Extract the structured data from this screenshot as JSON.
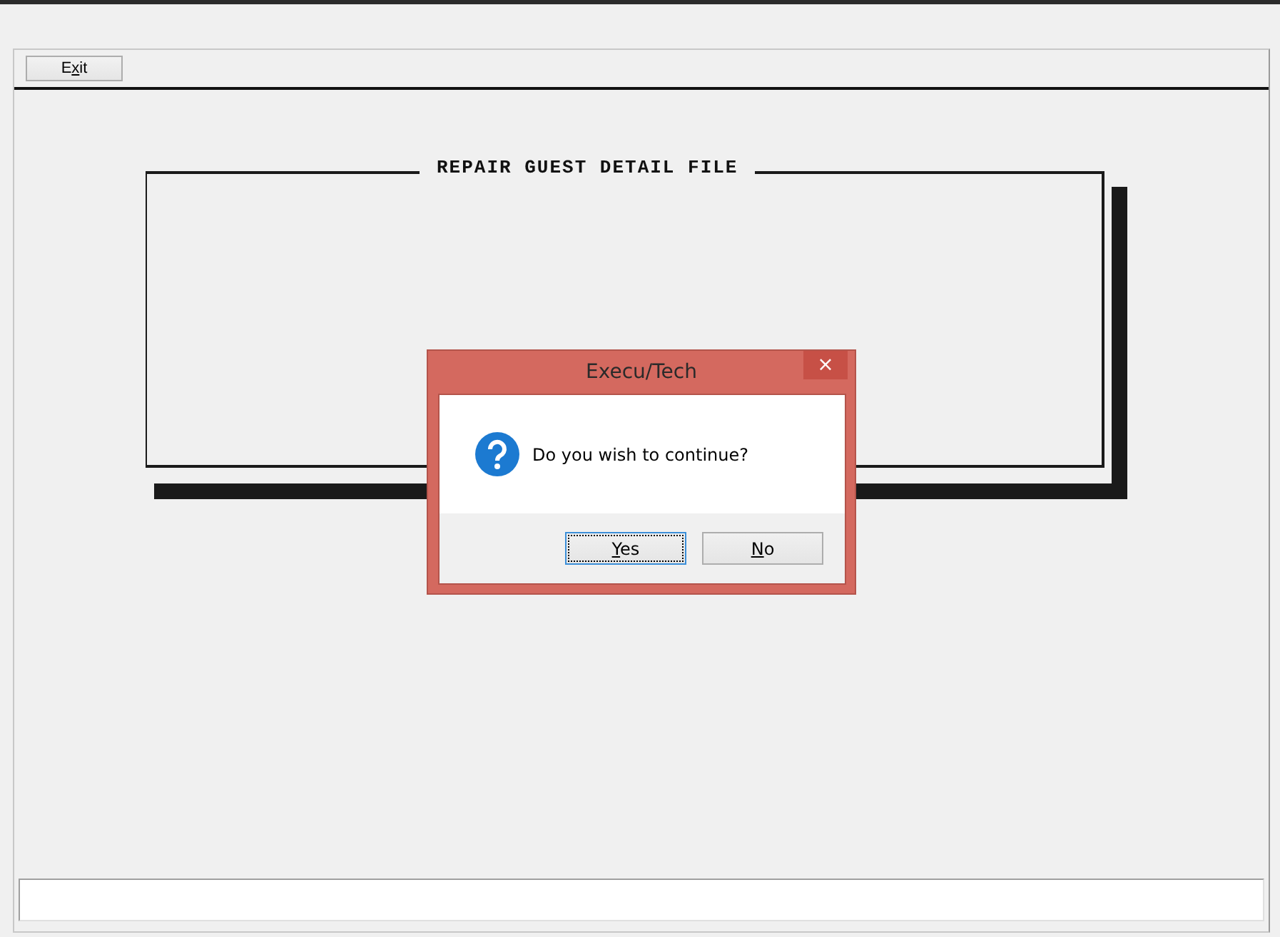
{
  "toolbar": {
    "buttons": [
      {
        "label_before": "E",
        "mnemonic": "x",
        "label_after": "it"
      }
    ]
  },
  "frame": {
    "title": "REPAIR GUEST DETAIL FILE"
  },
  "dialog": {
    "title": "Execu/Tech",
    "close": "×",
    "message": "Do you wish to continue?",
    "buttons": [
      {
        "mnemonic": "Y",
        "label_after": "es",
        "selected": true
      },
      {
        "mnemonic": "N",
        "label_after": "o",
        "selected": false
      }
    ]
  }
}
